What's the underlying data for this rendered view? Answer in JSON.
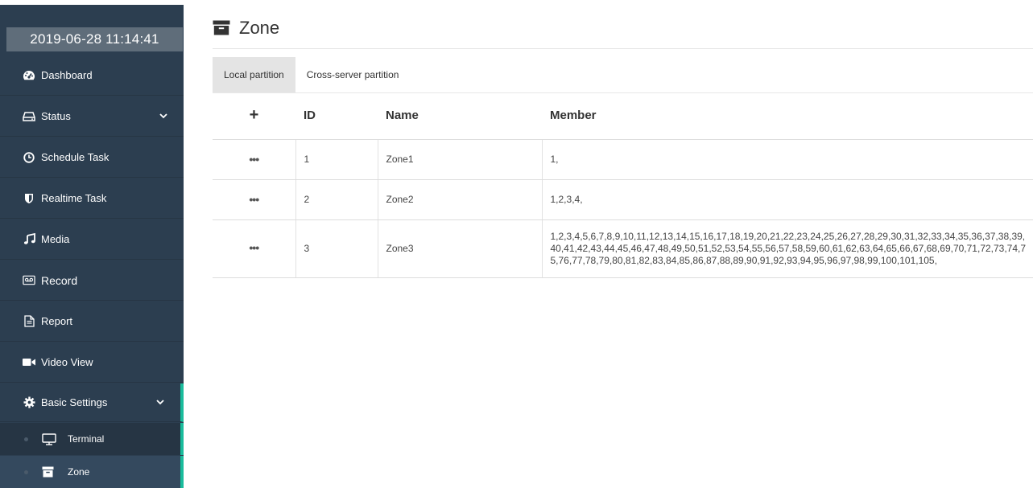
{
  "sidebar": {
    "clock": "2019-06-28 11:14:41",
    "items": [
      {
        "label": "Dashboard",
        "icon": "dashboard-icon"
      },
      {
        "label": "Status",
        "icon": "hdd-icon"
      },
      {
        "label": "Schedule Task",
        "icon": "clock-icon"
      },
      {
        "label": "Realtime Task",
        "icon": "shield-icon"
      },
      {
        "label": "Media",
        "icon": "music-icon"
      },
      {
        "label": "Record",
        "icon": "cassette-icon"
      },
      {
        "label": "Report",
        "icon": "document-icon"
      },
      {
        "label": "Video View",
        "icon": "video-camera-icon"
      },
      {
        "label": "Basic Settings",
        "icon": "gear-icon"
      }
    ],
    "sub_items": [
      {
        "label": "Terminal",
        "icon": "monitor-icon"
      },
      {
        "label": "Zone",
        "icon": "archive-box-icon"
      }
    ]
  },
  "main": {
    "title": "Zone",
    "title_icon": "archive-box-icon",
    "tabs": [
      {
        "label": "Local partition",
        "active": true
      },
      {
        "label": "Cross-server partition",
        "active": false
      }
    ],
    "table": {
      "add_symbol": "+",
      "headers": [
        "ID",
        "Name",
        "Member"
      ],
      "action_symbol": "•••",
      "rows": [
        {
          "id": "1",
          "name": "Zone1",
          "member": "1,"
        },
        {
          "id": "2",
          "name": "Zone2",
          "member": "1,2,3,4,"
        },
        {
          "id": "3",
          "name": "Zone3",
          "member": "1,2,3,4,5,6,7,8,9,10,11,12,13,14,15,16,17,18,19,20,21,22,23,24,25,26,27,28,29,30,31,32,33,34,35,36,37,38,39,40,41,42,43,44,45,46,47,48,49,50,51,52,53,54,55,56,57,58,59,60,61,62,63,64,65,66,67,68,69,70,71,72,73,74,75,76,77,78,79,80,81,82,83,84,85,86,87,88,89,90,91,92,93,94,95,96,97,98,99,100,101,105,"
        }
      ]
    }
  },
  "colors": {
    "sidebar_bg": "#2c3e50",
    "accent": "#1abc9c",
    "clock_bg": "#5f6d7a",
    "active_tab_bg": "#e4e4e4"
  }
}
